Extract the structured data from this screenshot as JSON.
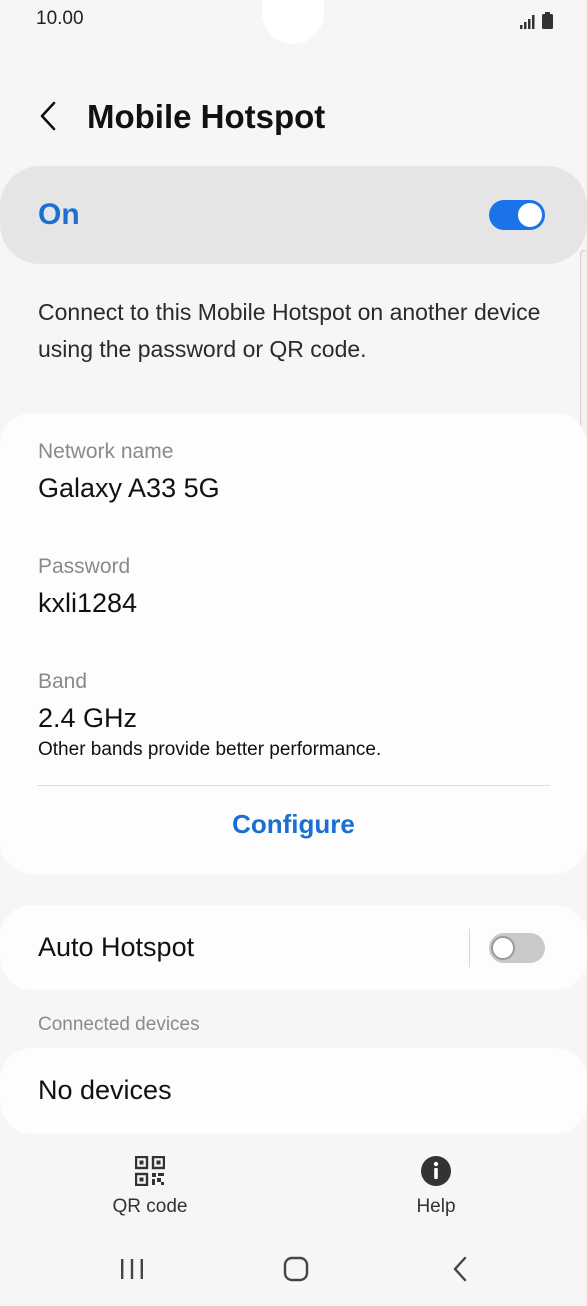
{
  "status_bar": {
    "time": "10.00",
    "icons": [
      "signal-icon",
      "battery-icon"
    ]
  },
  "header": {
    "title": "Mobile Hotspot",
    "back_icon": "chevron-left-icon"
  },
  "master_switch": {
    "label": "On",
    "enabled": true,
    "accent_color": "#1a73e8"
  },
  "description": "Connect to this Mobile Hotspot on another device using the password or QR code.",
  "details": {
    "network_name_label": "Network name",
    "network_name_value": "Galaxy A33 5G",
    "password_label": "Password",
    "password_value": "kxli1284",
    "band_label": "Band",
    "band_value": "2.4 GHz",
    "band_note": "Other bands provide better performance.",
    "configure_label": "Configure"
  },
  "auto_hotspot": {
    "label": "Auto Hotspot",
    "enabled": false
  },
  "connected_devices": {
    "header": "Connected devices",
    "empty_label": "No devices"
  },
  "bottom_actions": [
    {
      "label": "QR code",
      "icon": "qr-code-icon"
    },
    {
      "label": "Help",
      "icon": "info-icon"
    }
  ],
  "nav_bar": {
    "icons": [
      "recent-apps-icon",
      "home-icon",
      "back-icon"
    ]
  }
}
